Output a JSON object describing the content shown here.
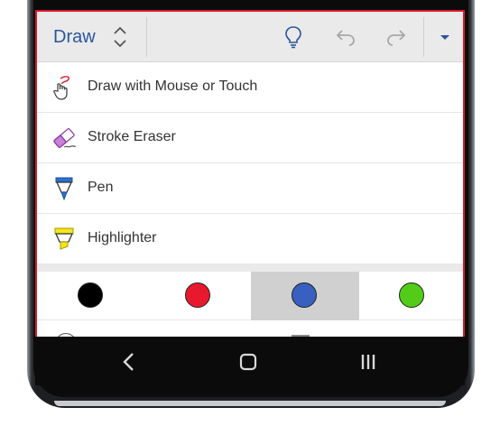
{
  "ribbon": {
    "tab_label": "Draw",
    "icons": [
      "updown-icon",
      "lightbulb-icon",
      "undo-icon",
      "redo-icon",
      "chevron-down-icon"
    ]
  },
  "menu": {
    "items": [
      {
        "label": "Draw with Mouse or Touch",
        "icon": "draw-touch-icon"
      },
      {
        "label": "Stroke Eraser",
        "icon": "eraser-icon"
      },
      {
        "label": "Pen",
        "icon": "pen-icon"
      },
      {
        "label": "Highlighter",
        "icon": "highlighter-icon"
      }
    ]
  },
  "colors": {
    "swatches": [
      {
        "name": "black",
        "hex": "#000000",
        "selected": false
      },
      {
        "name": "red",
        "hex": "#e8192c",
        "selected": false
      },
      {
        "name": "blue",
        "hex": "#3760c0",
        "selected": true
      },
      {
        "name": "green",
        "hex": "#52cc16",
        "selected": false
      }
    ]
  },
  "accent": "#2b579a",
  "nav": {
    "icons": [
      "back-icon",
      "home-icon",
      "recents-icon"
    ]
  }
}
